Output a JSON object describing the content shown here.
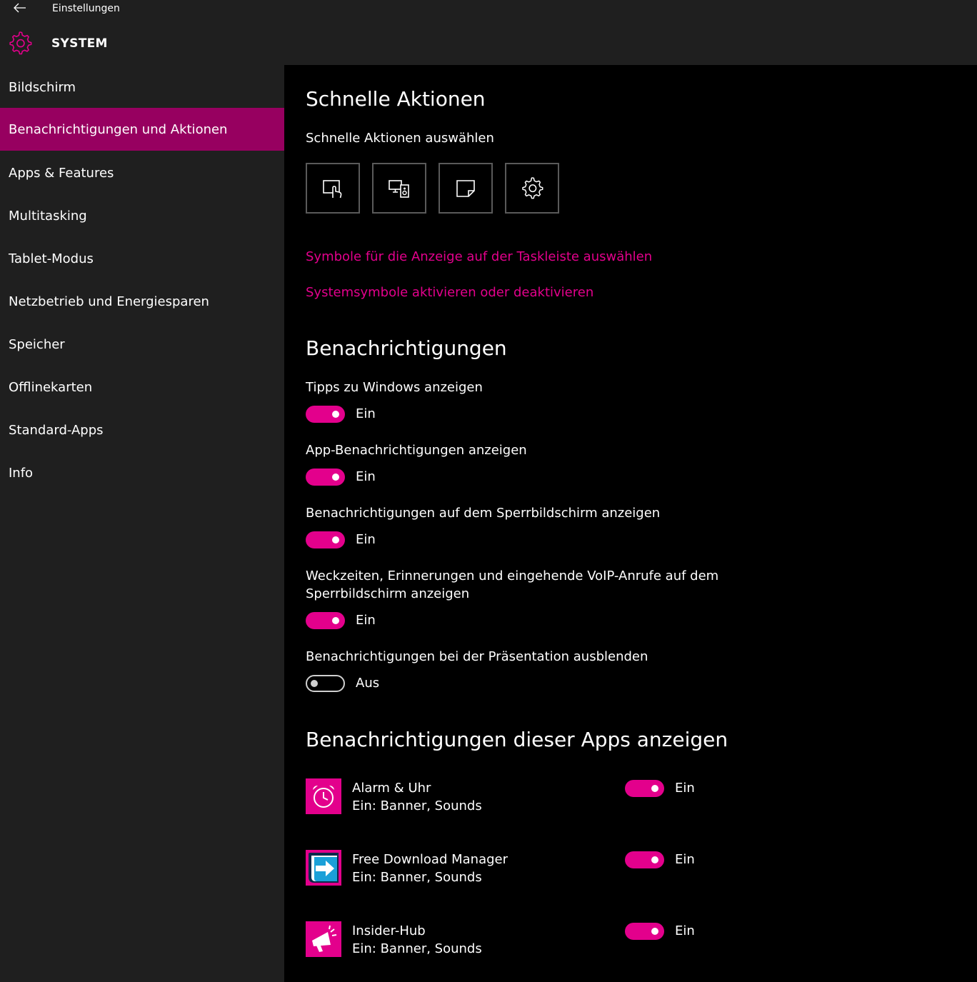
{
  "window": {
    "app_title": "Einstellungen",
    "section_title": "SYSTEM"
  },
  "sidebar": {
    "items": [
      {
        "label": "Bildschirm"
      },
      {
        "label": "Benachrichtigungen und Aktionen",
        "active": true
      },
      {
        "label": "Apps & Features"
      },
      {
        "label": "Multitasking"
      },
      {
        "label": "Tablet-Modus"
      },
      {
        "label": "Netzbetrieb und Energiesparen"
      },
      {
        "label": "Speicher"
      },
      {
        "label": "Offlinekarten"
      },
      {
        "label": "Standard-Apps"
      },
      {
        "label": "Info"
      }
    ]
  },
  "quick_actions": {
    "heading": "Schnelle Aktionen",
    "subheading": "Schnelle Aktionen auswählen",
    "tiles": [
      "tablet-mode-icon",
      "project-icon",
      "note-icon",
      "gear-icon"
    ],
    "link1": "Symbole für die Anzeige auf der Taskleiste auswählen",
    "link2": "Systemsymbole aktivieren oder deaktivieren"
  },
  "notifications": {
    "heading": "Benachrichtigungen",
    "settings": [
      {
        "label": "Tipps zu Windows anzeigen",
        "state": "Ein",
        "on": true
      },
      {
        "label": "App-Benachrichtigungen anzeigen",
        "state": "Ein",
        "on": true
      },
      {
        "label": "Benachrichtigungen auf dem Sperrbildschirm anzeigen",
        "state": "Ein",
        "on": true
      },
      {
        "label": "Weckzeiten, Erinnerungen und eingehende VoIP-Anrufe auf dem",
        "label2": "Sperrbildschirm anzeigen",
        "state": "Ein",
        "on": true
      },
      {
        "label": "Benachrichtigungen bei der Präsentation ausblenden",
        "state": "Aus",
        "on": false
      }
    ]
  },
  "apps": {
    "heading": "Benachrichtigungen dieser Apps anzeigen",
    "items": [
      {
        "name": "Alarm & Uhr",
        "sub": "Ein: Banner, Sounds",
        "state": "Ein",
        "icon": "alarm-clock-icon"
      },
      {
        "name": "Free Download Manager",
        "sub": "Ein: Banner, Sounds",
        "state": "Ein",
        "icon": "download-manager-icon"
      },
      {
        "name": "Insider-Hub",
        "sub": "Ein: Banner, Sounds",
        "state": "Ein",
        "icon": "megaphone-icon"
      }
    ]
  },
  "colors": {
    "accent": "#e3008c",
    "active_nav": "#970060",
    "sidebar_bg": "#1f1f1f",
    "content_bg": "#000000"
  }
}
